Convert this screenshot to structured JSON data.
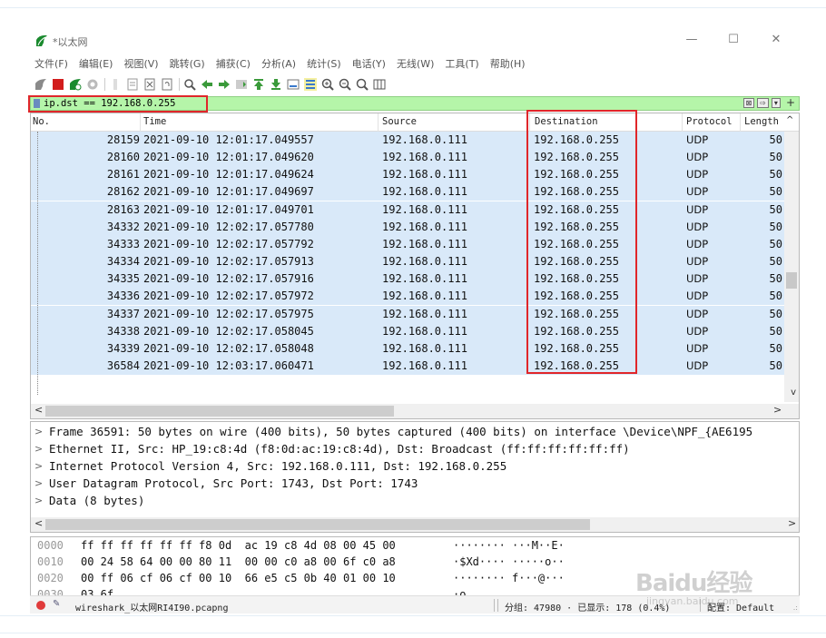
{
  "window": {
    "title": "*以太网",
    "minimize": "—",
    "maximize": "☐",
    "close": "✕"
  },
  "menu": [
    "文件(F)",
    "编辑(E)",
    "视图(V)",
    "跳转(G)",
    "捕获(C)",
    "分析(A)",
    "统计(S)",
    "电话(Y)",
    "无线(W)",
    "工具(T)",
    "帮助(H)"
  ],
  "filter": {
    "value": "ip.dst == 192.168.0.255",
    "clear_label": "⊠",
    "apply_label": "⇨",
    "dropdown_label": "▾",
    "add_label": "+"
  },
  "packet_list": {
    "columns": [
      "No.",
      "Time",
      "Source",
      "Destination",
      "Protocol",
      "Length"
    ],
    "rows": [
      {
        "no": "28159",
        "time": "2021-09-10 12:01:17.049557",
        "src": "192.168.0.111",
        "dst": "192.168.0.255",
        "proto": "UDP",
        "len": "50"
      },
      {
        "no": "28160",
        "time": "2021-09-10 12:01:17.049620",
        "src": "192.168.0.111",
        "dst": "192.168.0.255",
        "proto": "UDP",
        "len": "50"
      },
      {
        "no": "28161",
        "time": "2021-09-10 12:01:17.049624",
        "src": "192.168.0.111",
        "dst": "192.168.0.255",
        "proto": "UDP",
        "len": "50"
      },
      {
        "no": "28162",
        "time": "2021-09-10 12:01:17.049697",
        "src": "192.168.0.111",
        "dst": "192.168.0.255",
        "proto": "UDP",
        "len": "50"
      },
      {
        "no": "28163",
        "time": "2021-09-10 12:01:17.049701",
        "src": "192.168.0.111",
        "dst": "192.168.0.255",
        "proto": "UDP",
        "len": "50"
      },
      {
        "no": "34332",
        "time": "2021-09-10 12:02:17.057780",
        "src": "192.168.0.111",
        "dst": "192.168.0.255",
        "proto": "UDP",
        "len": "50"
      },
      {
        "no": "34333",
        "time": "2021-09-10 12:02:17.057792",
        "src": "192.168.0.111",
        "dst": "192.168.0.255",
        "proto": "UDP",
        "len": "50"
      },
      {
        "no": "34334",
        "time": "2021-09-10 12:02:17.057913",
        "src": "192.168.0.111",
        "dst": "192.168.0.255",
        "proto": "UDP",
        "len": "50"
      },
      {
        "no": "34335",
        "time": "2021-09-10 12:02:17.057916",
        "src": "192.168.0.111",
        "dst": "192.168.0.255",
        "proto": "UDP",
        "len": "50"
      },
      {
        "no": "34336",
        "time": "2021-09-10 12:02:17.057972",
        "src": "192.168.0.111",
        "dst": "192.168.0.255",
        "proto": "UDP",
        "len": "50"
      },
      {
        "no": "34337",
        "time": "2021-09-10 12:02:17.057975",
        "src": "192.168.0.111",
        "dst": "192.168.0.255",
        "proto": "UDP",
        "len": "50"
      },
      {
        "no": "34338",
        "time": "2021-09-10 12:02:17.058045",
        "src": "192.168.0.111",
        "dst": "192.168.0.255",
        "proto": "UDP",
        "len": "50"
      },
      {
        "no": "34339",
        "time": "2021-09-10 12:02:17.058048",
        "src": "192.168.0.111",
        "dst": "192.168.0.255",
        "proto": "UDP",
        "len": "50"
      },
      {
        "no": "36584",
        "time": "2021-09-10 12:03:17.060471",
        "src": "192.168.0.111",
        "dst": "192.168.0.255",
        "proto": "UDP",
        "len": "50"
      }
    ]
  },
  "details": [
    {
      "arrow": ">",
      "text": "Frame 36591: 50 bytes on wire (400 bits), 50 bytes captured (400 bits) on interface \\Device\\NPF_{AE6195"
    },
    {
      "arrow": ">",
      "text": "Ethernet II, Src: HP_19:c8:4d (f8:0d:ac:19:c8:4d), Dst: Broadcast (ff:ff:ff:ff:ff:ff)"
    },
    {
      "arrow": ">",
      "text": "Internet Protocol Version 4, Src: 192.168.0.111, Dst: 192.168.0.255"
    },
    {
      "arrow": ">",
      "text": "User Datagram Protocol, Src Port: 1743, Dst Port: 1743"
    },
    {
      "arrow": ">",
      "text": "Data (8 bytes)"
    }
  ],
  "bytes": [
    {
      "offset": "0000",
      "hex": "ff ff ff ff ff ff f8 0d  ac 19 c8 4d 08 00 45 00",
      "ascii": "········ ···M··E·"
    },
    {
      "offset": "0010",
      "hex": "00 24 58 64 00 00 80 11  00 00 c0 a8 00 6f c0 a8",
      "ascii": "·$Xd···· ·····o··"
    },
    {
      "offset": "0020",
      "hex": "00 ff 06 cf 06 cf 00 10  66 e5 c5 0b 40 01 00 10",
      "ascii": "········ f···@···"
    },
    {
      "offset": "0030",
      "hex": "03 6f",
      "ascii": "·o"
    }
  ],
  "status": {
    "file": "wireshark_以太网RI4I90.pcapng",
    "stats": "分组: 47980 · 已显示: 178 (0.4%)",
    "profile": "配置: Default"
  },
  "watermark": {
    "main": "Baidu经验",
    "sub": "jingyan.baidu.com"
  },
  "colors": {
    "filter_bg": "#b5f5a9",
    "row_bg": "#d9e9f9",
    "highlight": "#e0262a"
  }
}
